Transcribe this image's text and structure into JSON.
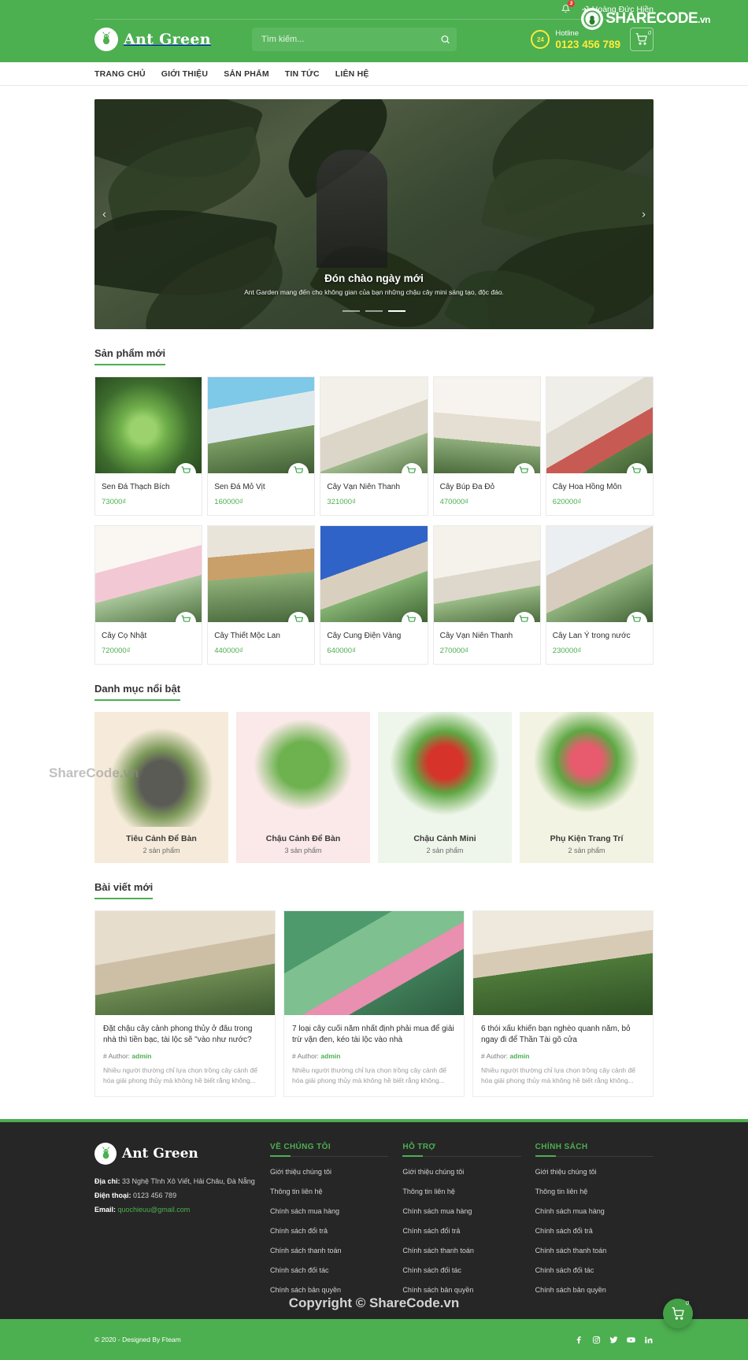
{
  "topbar": {
    "bell_icon": "bell-icon",
    "bell_badge": "3",
    "login_icon": "login-icon",
    "user_name": "Hoàng Đức Hiền"
  },
  "brand": {
    "name": "Ant Green",
    "logo_icon": "ant-logo-icon"
  },
  "search": {
    "placeholder": "Tìm kiếm...",
    "value": "",
    "icon": "search-icon"
  },
  "hotline": {
    "badge": "24",
    "label": "Hotline",
    "number": "0123 456 789",
    "icon": "phone-24h-icon"
  },
  "cart": {
    "icon": "cart-icon",
    "count": "0"
  },
  "nav": {
    "items": [
      {
        "label": "TRANG CHỦ"
      },
      {
        "label": "GIỚI THIỆU"
      },
      {
        "label": "SẢN PHẨM"
      },
      {
        "label": "TIN TỨC"
      },
      {
        "label": "LIÊN HỆ"
      }
    ]
  },
  "hero": {
    "title": "Đón chào ngày mới",
    "subtitle": "Ant Garden mang đến cho không gian của bạn những chậu cây mini sáng tạo, độc đáo.",
    "prev_icon": "chevron-left-icon",
    "next_icon": "chevron-right-icon",
    "dots": 3,
    "active_dot": 2
  },
  "sections": {
    "products_title": "Sản phẩm mới",
    "categories_title": "Danh mục nổi bật",
    "blog_title": "Bài viết mới"
  },
  "products": [
    {
      "name": "Sen Đá Thạch Bích",
      "price": "73000₫",
      "cart_icon": "add-to-cart-icon"
    },
    {
      "name": "Sen Đá Mỏ Vịt",
      "price": "160000₫",
      "cart_icon": "add-to-cart-icon"
    },
    {
      "name": "Cây Vạn Niên Thanh",
      "price": "321000₫",
      "cart_icon": "add-to-cart-icon"
    },
    {
      "name": "Cây Búp Đa Đỏ",
      "price": "470000₫",
      "cart_icon": "add-to-cart-icon"
    },
    {
      "name": "Cây Hoa Hồng Môn",
      "price": "620000₫",
      "cart_icon": "add-to-cart-icon"
    },
    {
      "name": "Cây Cọ Nhật",
      "price": "720000₫",
      "cart_icon": "add-to-cart-icon"
    },
    {
      "name": "Cây Thiết Mộc Lan",
      "price": "440000₫",
      "cart_icon": "add-to-cart-icon"
    },
    {
      "name": "Cây Cung Điện Vàng",
      "price": "640000₫",
      "cart_icon": "add-to-cart-icon"
    },
    {
      "name": "Cây Vạn Niên Thanh",
      "price": "270000₫",
      "cart_icon": "add-to-cart-icon"
    },
    {
      "name": "Cây Lan Ý trong nước",
      "price": "230000₫",
      "cart_icon": "add-to-cart-icon"
    }
  ],
  "categories": [
    {
      "name": "Tiêu Cảnh Để Bàn",
      "count": "2 sản phẩm",
      "bg": "#f6ebda"
    },
    {
      "name": "Chậu Cảnh Để Bàn",
      "count": "3 sản phẩm",
      "bg": "#fae9e8"
    },
    {
      "name": "Chậu Cảnh Mini",
      "count": "2 sản phẩm",
      "bg": "#eef5ea"
    },
    {
      "name": "Phụ Kiện Trang Trí",
      "count": "2 sản phẩm",
      "bg": "#f2f3e2"
    }
  ],
  "blog": [
    {
      "title": "Đặt chậu cây cảnh phong thủy ở đâu trong nhà thì tiền bạc, tài lộc sẽ \"vào như nước?",
      "author_prefix": "# Author:",
      "author": "admin",
      "excerpt": "Nhiều người thường chỉ lựa chọn trồng cây cảnh để hóa giải phong thủy mà không hề biết rằng không..."
    },
    {
      "title": "7 loại cây cuối năm nhất định phải mua để giải trừ vận đen, kéo tài lộc vào nhà",
      "author_prefix": "# Author:",
      "author": "admin",
      "excerpt": "Nhiều người thường chỉ lựa chọn trồng cây cảnh để hóa giải phong thủy mà không hề biết rằng không..."
    },
    {
      "title": "6 thói xấu khiến bạn nghèo quanh năm, bỏ ngay đi để Thần Tài gõ cửa",
      "author_prefix": "# Author:",
      "author": "admin",
      "excerpt": "Nhiều người thường chỉ lựa chọn trồng cây cảnh để hóa giải phong thủy mà không hề biết rằng không..."
    }
  ],
  "footer": {
    "brand": "Ant Green",
    "address_label": "Địa chỉ:",
    "address": "33 Nghệ Tĩnh Xô Viết, Hải Châu, Đà Nẵng",
    "phone_label": "Điện thoại:",
    "phone": "0123 456 789",
    "email_label": "Email:",
    "email": "quochieuu@gmail.com",
    "columns": [
      {
        "title": "VỀ CHÚNG TÔI",
        "links": [
          "Giới thiệu chúng tôi",
          "Thông tin liên hệ",
          "Chính sách mua hàng",
          "Chính sách đổi trả",
          "Chính sách thanh toán",
          "Chính sách đối tác",
          "Chính sách bản quyền"
        ]
      },
      {
        "title": "HỖ TRỢ",
        "links": [
          "Giới thiệu chúng tôi",
          "Thông tin liên hệ",
          "Chính sách mua hàng",
          "Chính sách đổi trả",
          "Chính sách thanh toán",
          "Chính sách đối tác",
          "Chính sách bản quyền"
        ]
      },
      {
        "title": "CHÍNH SÁCH",
        "links": [
          "Giới thiệu chúng tôi",
          "Thông tin liên hệ",
          "Chính sách mua hàng",
          "Chính sách đổi trả",
          "Chính sách thanh toán",
          "Chính sách đối tác",
          "Chính sách bản quyền"
        ]
      }
    ]
  },
  "bottom": {
    "copyright": "© 2020 - Designed By Fteam",
    "socials": [
      "facebook-icon",
      "instagram-icon",
      "twitter-icon",
      "youtube-icon",
      "linkedin-icon"
    ],
    "float_cart_icon": "cart-icon",
    "float_cart_count": "0"
  },
  "watermarks": {
    "top_right": "SHARECODE",
    "top_right_suffix": ".vn",
    "center": "ShareCode.vn",
    "footer": "Copyright © ShareCode.vn"
  },
  "colors": {
    "brand_green": "#4caf50",
    "accent_yellow": "#ffeb3b",
    "footer_dark": "#262626"
  }
}
